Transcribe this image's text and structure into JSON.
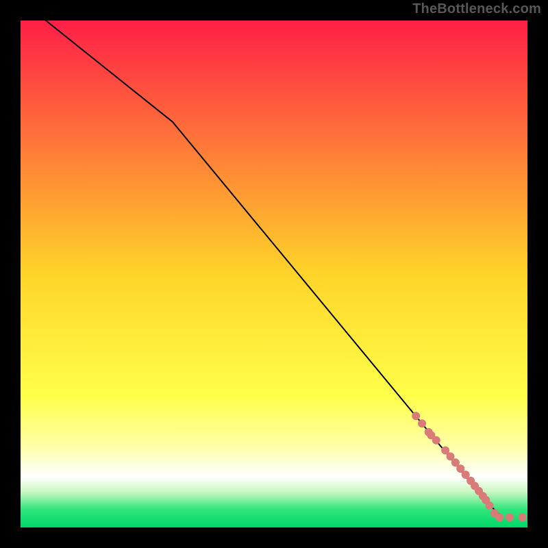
{
  "watermark": "TheBottleneck.com",
  "chart_data": {
    "type": "scatter",
    "title": "",
    "xlabel": "",
    "ylabel": "",
    "xlim": [
      0,
      100
    ],
    "ylim": [
      0,
      100
    ],
    "grid": false,
    "legend": false,
    "background": {
      "type": "vertical-gradient",
      "stops": [
        {
          "pos": 0.0,
          "color": "#ff1f47"
        },
        {
          "pos": 0.5,
          "color": "#ffd429"
        },
        {
          "pos": 0.74,
          "color": "#ffff49"
        },
        {
          "pos": 0.84,
          "color": "#ffffa8"
        },
        {
          "pos": 0.9,
          "color": "#ffffff"
        },
        {
          "pos": 0.93,
          "color": "#c9f7c0"
        },
        {
          "pos": 0.965,
          "color": "#2fe57a"
        },
        {
          "pos": 1.0,
          "color": "#00d768"
        }
      ]
    },
    "series": [
      {
        "name": "curve",
        "render": "line",
        "color": "#000000",
        "stroke_width": 2,
        "points": [
          {
            "x": 5,
            "y": 100
          },
          {
            "x": 30,
            "y": 80
          },
          {
            "x": 92,
            "y": 5
          },
          {
            "x": 95,
            "y": 2
          }
        ]
      },
      {
        "name": "dots",
        "render": "points",
        "color": "#d97b78",
        "radius": 6,
        "points": [
          {
            "x": 78.0,
            "y": 22.0
          },
          {
            "x": 79.2,
            "y": 20.5
          },
          {
            "x": 80.5,
            "y": 18.8
          },
          {
            "x": 81.0,
            "y": 18.2
          },
          {
            "x": 82.0,
            "y": 17.2
          },
          {
            "x": 83.8,
            "y": 15.2
          },
          {
            "x": 84.8,
            "y": 14.0
          },
          {
            "x": 85.8,
            "y": 12.8
          },
          {
            "x": 86.8,
            "y": 11.6
          },
          {
            "x": 87.8,
            "y": 10.4
          },
          {
            "x": 88.8,
            "y": 9.2
          },
          {
            "x": 89.6,
            "y": 8.2
          },
          {
            "x": 90.4,
            "y": 7.2
          },
          {
            "x": 91.2,
            "y": 6.2
          },
          {
            "x": 91.8,
            "y": 5.4
          },
          {
            "x": 92.5,
            "y": 4.3
          },
          {
            "x": 93.5,
            "y": 2.8
          },
          {
            "x": 94.5,
            "y": 2.0
          },
          {
            "x": 96.5,
            "y": 2.0
          },
          {
            "x": 99.0,
            "y": 2.0
          }
        ]
      }
    ]
  }
}
